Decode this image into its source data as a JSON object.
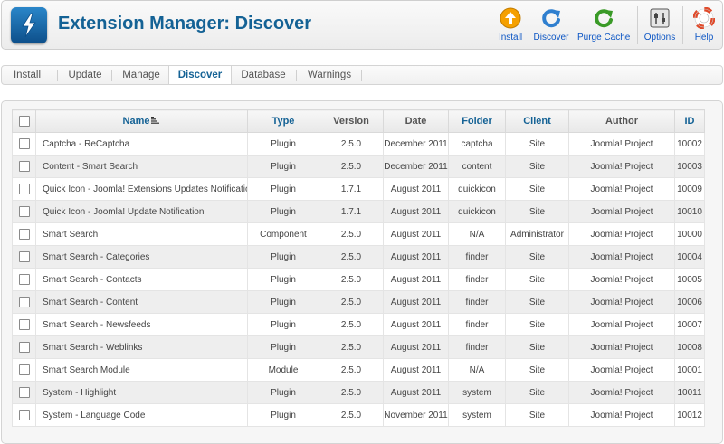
{
  "header": {
    "title": "Extension Manager: Discover",
    "buttons": [
      {
        "label": "Install",
        "icon": "install-icon",
        "color": "#f5a000"
      },
      {
        "label": "Discover",
        "icon": "discover-icon",
        "color": "#2f7fcf"
      },
      {
        "label": "Purge Cache",
        "icon": "purge-cache-icon",
        "color": "#3a9a27"
      },
      {
        "label": "Options",
        "icon": "options-icon"
      },
      {
        "label": "Help",
        "icon": "help-icon",
        "color": "#e04a2a"
      }
    ]
  },
  "tabs": [
    "Install",
    "Update",
    "Manage",
    "Discover",
    "Database",
    "Warnings"
  ],
  "active_tab": "Discover",
  "table": {
    "columns": [
      "Name",
      "Type",
      "Version",
      "Date",
      "Folder",
      "Client",
      "Author",
      "ID"
    ],
    "rows": [
      [
        "Captcha - ReCaptcha",
        "Plugin",
        "2.5.0",
        "December 2011",
        "captcha",
        "Site",
        "Joomla! Project",
        "10002"
      ],
      [
        "Content - Smart Search",
        "Plugin",
        "2.5.0",
        "December 2011",
        "content",
        "Site",
        "Joomla! Project",
        "10003"
      ],
      [
        "Quick Icon - Joomla! Extensions Updates Notification",
        "Plugin",
        "1.7.1",
        "August 2011",
        "quickicon",
        "Site",
        "Joomla! Project",
        "10009"
      ],
      [
        "Quick Icon - Joomla! Update Notification",
        "Plugin",
        "1.7.1",
        "August 2011",
        "quickicon",
        "Site",
        "Joomla! Project",
        "10010"
      ],
      [
        "Smart Search",
        "Component",
        "2.5.0",
        "August 2011",
        "N/A",
        "Administrator",
        "Joomla! Project",
        "10000"
      ],
      [
        "Smart Search - Categories",
        "Plugin",
        "2.5.0",
        "August 2011",
        "finder",
        "Site",
        "Joomla! Project",
        "10004"
      ],
      [
        "Smart Search - Contacts",
        "Plugin",
        "2.5.0",
        "August 2011",
        "finder",
        "Site",
        "Joomla! Project",
        "10005"
      ],
      [
        "Smart Search - Content",
        "Plugin",
        "2.5.0",
        "August 2011",
        "finder",
        "Site",
        "Joomla! Project",
        "10006"
      ],
      [
        "Smart Search - Newsfeeds",
        "Plugin",
        "2.5.0",
        "August 2011",
        "finder",
        "Site",
        "Joomla! Project",
        "10007"
      ],
      [
        "Smart Search - Weblinks",
        "Plugin",
        "2.5.0",
        "August 2011",
        "finder",
        "Site",
        "Joomla! Project",
        "10008"
      ],
      [
        "Smart Search Module",
        "Module",
        "2.5.0",
        "August 2011",
        "N/A",
        "Site",
        "Joomla! Project",
        "10001"
      ],
      [
        "System - Highlight",
        "Plugin",
        "2.5.0",
        "August 2011",
        "system",
        "Site",
        "Joomla! Project",
        "10011"
      ],
      [
        "System - Language Code",
        "Plugin",
        "2.5.0",
        "November 2011",
        "system",
        "Site",
        "Joomla! Project",
        "10012"
      ]
    ]
  }
}
